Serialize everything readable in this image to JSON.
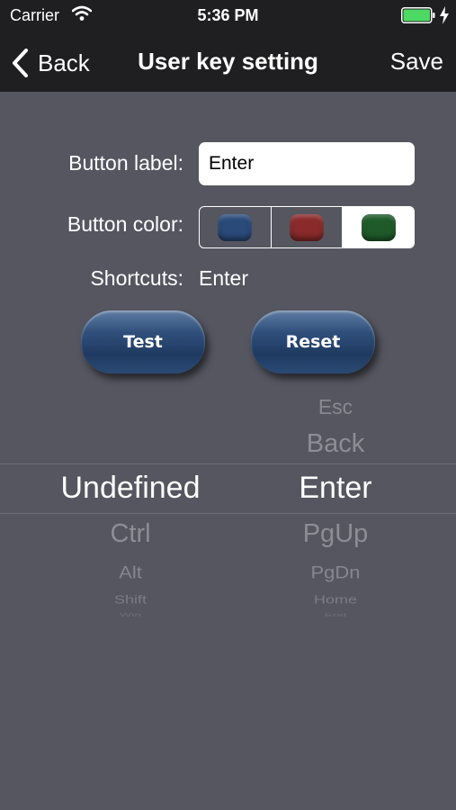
{
  "status_bar": {
    "carrier": "Carrier",
    "time": "5:36 PM"
  },
  "nav": {
    "back_label": "Back",
    "title": "User key setting",
    "save_label": "Save"
  },
  "form": {
    "button_label_caption": "Button label:",
    "button_label_value": "Enter",
    "button_color_caption": "Button color:",
    "color_options": [
      {
        "name": "blue",
        "hex": "#2a4a7a",
        "selected": false
      },
      {
        "name": "red",
        "hex": "#8a2a2a",
        "selected": false
      },
      {
        "name": "green",
        "hex": "#1f5a2a",
        "selected": true
      }
    ],
    "shortcuts_caption": "Shortcuts:",
    "shortcuts_value": "Enter"
  },
  "actions": {
    "test_label": "Test",
    "reset_label": "Reset"
  },
  "picker": {
    "modifier_column": {
      "selected": "Undefined",
      "below": [
        "Ctrl",
        "Alt",
        "Shift",
        "Win"
      ]
    },
    "key_column": {
      "above": [
        "Esc",
        "Back"
      ],
      "selected": "Enter",
      "below": [
        "PgUp",
        "PgDn",
        "Home",
        "End"
      ]
    }
  },
  "colors": {
    "background": "#555660",
    "nav_bar": "#1f1f21",
    "battery": "#4cd964"
  }
}
